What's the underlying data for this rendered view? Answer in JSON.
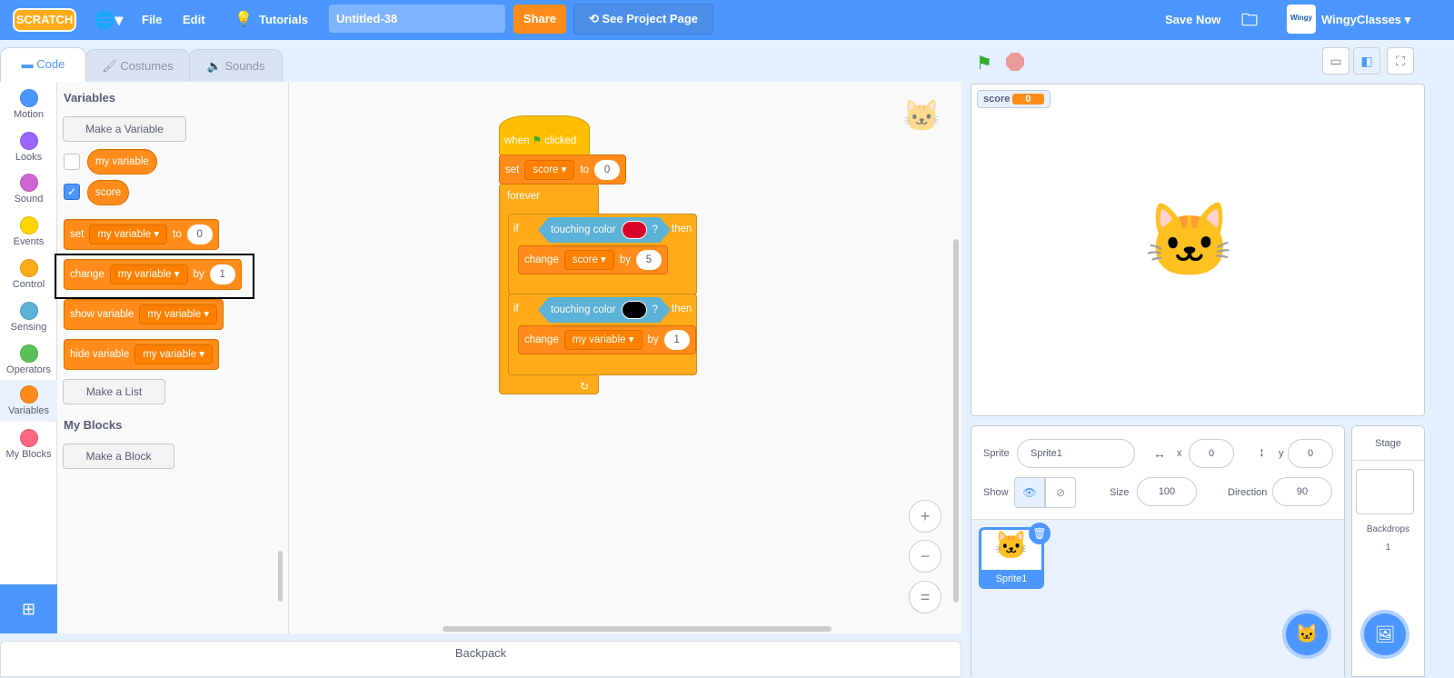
{
  "menubar": {
    "logo": "SCRATCH",
    "file": "File",
    "edit": "Edit",
    "tutorials": "Tutorials",
    "project_title": "Untitled-38",
    "share": "Share",
    "see_project_page": "See Project Page",
    "save_now": "Save Now",
    "username": "WingyClasses",
    "avatar_text": "Wingy"
  },
  "tabs": [
    {
      "label": "Code"
    },
    {
      "label": "Costumes"
    },
    {
      "label": "Sounds"
    }
  ],
  "categories": [
    {
      "label": "Motion",
      "color": "#4c97ff"
    },
    {
      "label": "Looks",
      "color": "#9966ff"
    },
    {
      "label": "Sound",
      "color": "#cf63cf"
    },
    {
      "label": "Events",
      "color": "#ffd500"
    },
    {
      "label": "Control",
      "color": "#ffab19"
    },
    {
      "label": "Sensing",
      "color": "#5cb1d6"
    },
    {
      "label": "Operators",
      "color": "#59c059"
    },
    {
      "label": "Variables",
      "color": "#ff8c1a"
    },
    {
      "label": "My Blocks",
      "color": "#ff6680"
    }
  ],
  "palette": {
    "variables_heading": "Variables",
    "make_variable": "Make a Variable",
    "var1": "my variable",
    "var2": "score",
    "set_block": {
      "t1": "set",
      "var": "my variable",
      "t2": "to",
      "val": "0"
    },
    "change_block": {
      "t1": "change",
      "var": "my variable",
      "t2": "by",
      "val": "1"
    },
    "show_block": {
      "t1": "show variable",
      "var": "my variable"
    },
    "hide_block": {
      "t1": "hide variable",
      "var": "my variable"
    },
    "make_list": "Make a List",
    "myblocks_heading": "My Blocks",
    "make_block": "Make a Block"
  },
  "script": {
    "hat": {
      "t1": "when",
      "t2": "clicked"
    },
    "set": {
      "t1": "set",
      "var": "score",
      "t2": "to",
      "val": "0"
    },
    "forever": "forever",
    "if1": {
      "t1": "if",
      "sense": "touching color",
      "q": "?",
      "then": "then",
      "color": "#d9002b"
    },
    "change1": {
      "t1": "change",
      "var": "score",
      "t2": "by",
      "val": "5"
    },
    "if2": {
      "t1": "if",
      "sense": "touching color",
      "q": "?",
      "then": "then",
      "color": "#000000"
    },
    "change2": {
      "t1": "change",
      "var": "my variable",
      "t2": "by",
      "val": "1"
    }
  },
  "zoom": {
    "in": "+",
    "out": "−",
    "reset": "="
  },
  "backpack": "Backpack",
  "stage": {
    "monitor_label": "score",
    "monitor_value": "0"
  },
  "sprite_info": {
    "sprite_label": "Sprite",
    "sprite_name": "Sprite1",
    "x_label": "x",
    "x": "0",
    "y_label": "y",
    "y": "0",
    "show_label": "Show",
    "size_label": "Size",
    "size": "100",
    "direction_label": "Direction",
    "direction": "90"
  },
  "sprites": [
    {
      "name": "Sprite1"
    }
  ],
  "stage_pane": {
    "title": "Stage",
    "backdrops_label": "Backdrops",
    "backdrops_count": "1"
  }
}
